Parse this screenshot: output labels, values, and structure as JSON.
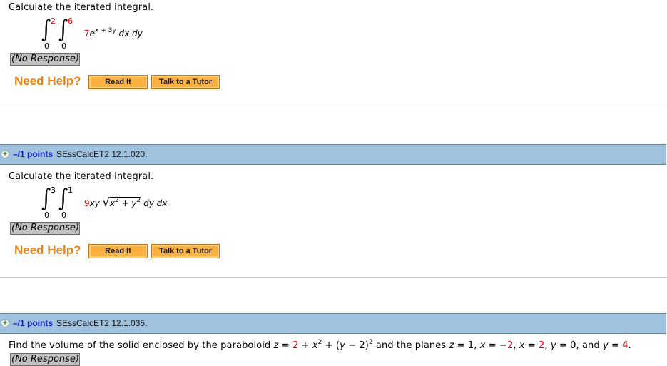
{
  "questions": [
    {
      "prompt": "Calculate the iterated integral.",
      "integral": {
        "outer": {
          "lower": "0",
          "upper": "2"
        },
        "inner": {
          "lower": "0",
          "upper": "6"
        },
        "coef": "7",
        "base": "e",
        "exponent": "x + 3y",
        "differentials": "dx dy"
      },
      "response": "(No Response)",
      "help_label": "Need Help?",
      "buttons": {
        "read": "Read It",
        "tutor": "Talk to a Tutor"
      }
    },
    {
      "header": {
        "points": "–/1 points",
        "id": "SEssCalcET2 12.1.020."
      },
      "prompt": "Calculate the iterated integral.",
      "integral": {
        "outer": {
          "lower": "0",
          "upper": "3"
        },
        "inner": {
          "lower": "0",
          "upper": "1"
        },
        "coef": "9",
        "vars": "xy",
        "radicand_x": "x",
        "radicand_op": " + ",
        "radicand_y": "y",
        "power": "2",
        "differentials": "dy dx"
      },
      "response": "(No Response)",
      "help_label": "Need Help?",
      "buttons": {
        "read": "Read It",
        "tutor": "Talk to a Tutor"
      }
    },
    {
      "header": {
        "points": "–/1 points",
        "id": "SEssCalcET2 12.1.035."
      },
      "prompt_parts": {
        "p1": "Find the volume of the solid enclosed by the paraboloid ",
        "z": "z",
        "eq1": " = ",
        "c1": "2",
        "p2": " + ",
        "x": "x",
        "sq": "2",
        "p3": " + (",
        "y": "y",
        "p4": " − 2)",
        "sq2": "2",
        "p5": " and the planes ",
        "z2": "z",
        "p6": " = 1, ",
        "x2": "x",
        "p7": " = −",
        "c2": "2",
        "p8": ", ",
        "x3": "x",
        "p9": " = ",
        "c3": "2",
        "p10": ", ",
        "y2": "y",
        "p11": " = 0, and ",
        "y3": "y",
        "p12": " = ",
        "c4": "4",
        "p13": "."
      },
      "response": "(No Response)"
    }
  ],
  "colors": {
    "accent_red": "#e00000",
    "help_orange": "#e8831a",
    "button_orange": "#fbb040",
    "header_blue": "#9fc2df",
    "points_blue": "#1020c8"
  },
  "icons": {
    "expand": "plus-circle-icon"
  }
}
